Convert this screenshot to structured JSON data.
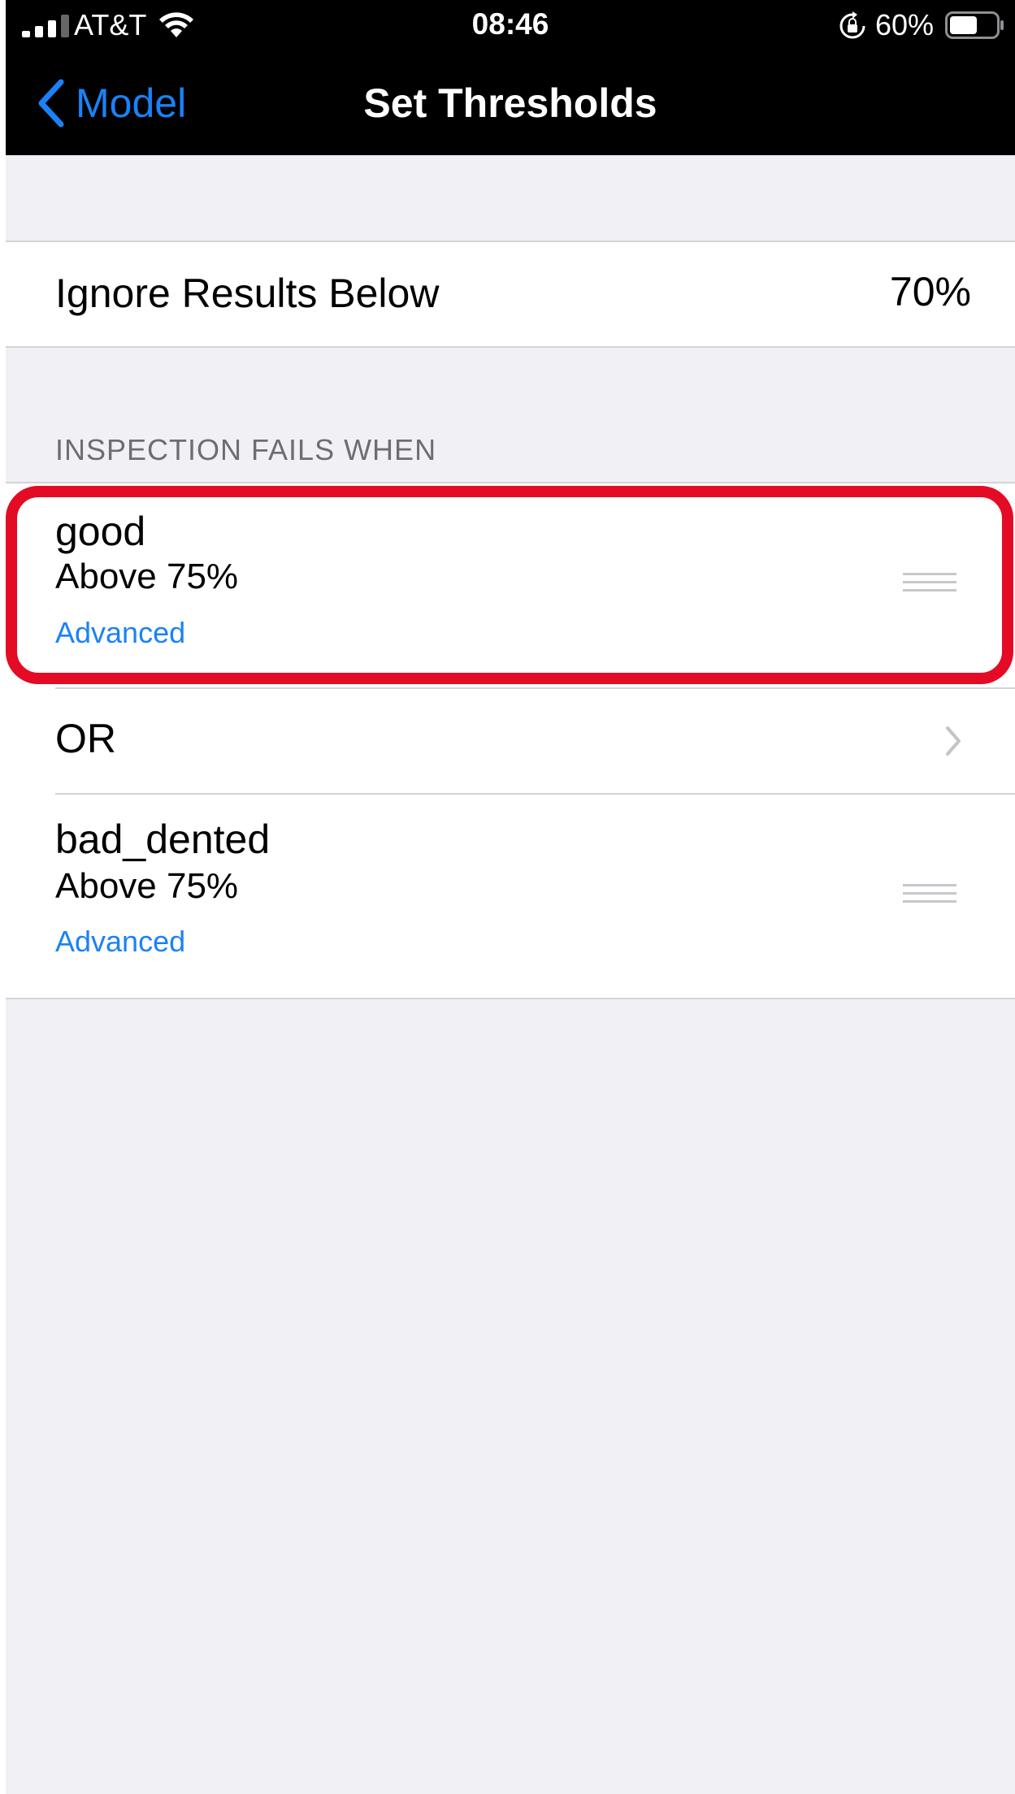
{
  "status_bar": {
    "carrier": "AT&T",
    "time": "08:46",
    "battery": "60%",
    "battery_level": 0.6
  },
  "nav": {
    "back_label": "Model",
    "title": "Set Thresholds"
  },
  "ignore_row": {
    "label": "Ignore Results Below",
    "value": "70%"
  },
  "section": {
    "header": "INSPECTION FAILS WHEN"
  },
  "rules": [
    {
      "name": "good",
      "condition": "Above 75%",
      "link": "Advanced"
    },
    {
      "name": "bad_dented",
      "condition": "Above 75%",
      "link": "Advanced"
    }
  ],
  "operator": {
    "label": "OR"
  },
  "colors": {
    "accent": "#1a82f7",
    "highlight": "#e40b25",
    "background": "#f0f0f5"
  }
}
